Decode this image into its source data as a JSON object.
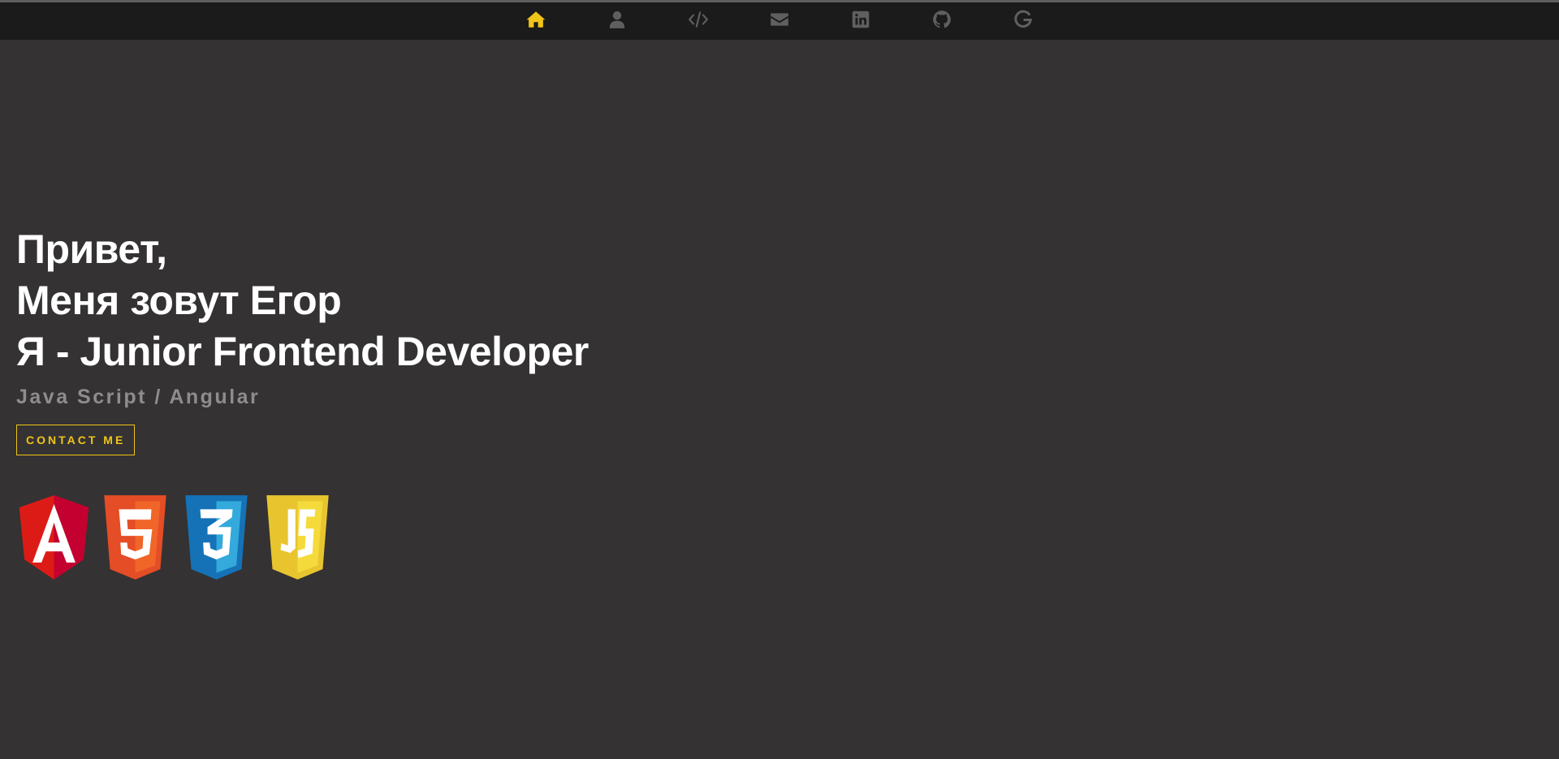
{
  "nav": {
    "items": [
      {
        "name": "home",
        "icon": "home-icon",
        "active": true
      },
      {
        "name": "about",
        "icon": "user-icon",
        "active": false
      },
      {
        "name": "projects",
        "icon": "code-icon",
        "active": false
      },
      {
        "name": "contact",
        "icon": "envelope-icon",
        "active": false
      },
      {
        "name": "linkedin",
        "icon": "linkedin-icon",
        "active": false
      },
      {
        "name": "github",
        "icon": "github-icon",
        "active": false
      },
      {
        "name": "google",
        "icon": "google-icon",
        "active": false
      }
    ],
    "active_color": "#f0c419",
    "inactive_color": "#5f5f5f"
  },
  "hero": {
    "line1": "Привет,",
    "line2": "Меня зовут Егор",
    "line3": "Я - Junior Frontend Developer",
    "subtitle": "Java Script / Angular",
    "button": "CONTACT ME"
  },
  "tech_logos": [
    {
      "name": "Angular",
      "icon": "angular-icon",
      "color": "#dd1b16",
      "letter": "A"
    },
    {
      "name": "HTML5",
      "icon": "html5-icon",
      "color": "#e44d26",
      "letter": "5"
    },
    {
      "name": "CSS3",
      "icon": "css3-icon",
      "color": "#1572b6",
      "letter": "3"
    },
    {
      "name": "JavaScript",
      "icon": "javascript-icon",
      "color": "#f0db4f",
      "letter": "JS"
    }
  ]
}
